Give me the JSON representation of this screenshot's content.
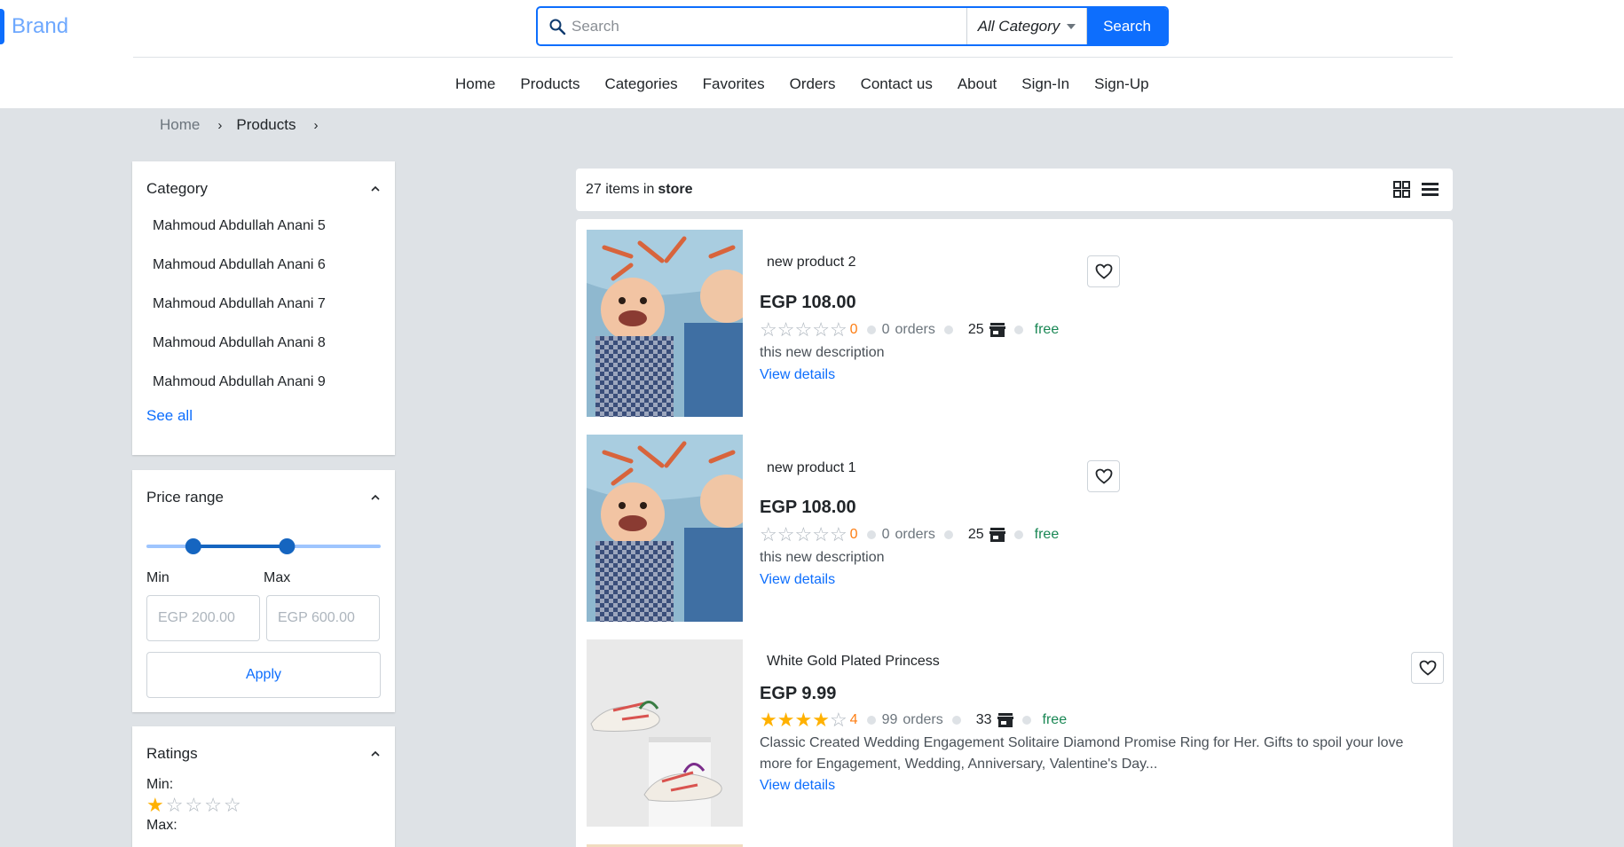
{
  "brand": {
    "name": "Brand",
    "accent": "#0d6efd"
  },
  "search": {
    "placeholder": "Search",
    "category_selected": "All Category",
    "button_label": "Search"
  },
  "nav": {
    "items": [
      "Home",
      "Products",
      "Categories",
      "Favorites",
      "Orders",
      "Contact us",
      "About",
      "Sign-In",
      "Sign-Up"
    ]
  },
  "breadcrumb": {
    "home": "Home",
    "current": "Products"
  },
  "sidebar": {
    "category": {
      "title": "Category",
      "items": [
        "Mahmoud Abdullah Anani 5",
        "Mahmoud Abdullah Anani 6",
        "Mahmoud Abdullah Anani 7",
        "Mahmoud Abdullah Anani 8",
        "Mahmoud Abdullah Anani 9"
      ],
      "see_all": "See all"
    },
    "price": {
      "title": "Price range",
      "range_min_fraction": 0.2,
      "range_max_fraction": 0.6,
      "min_label": "Min",
      "max_label": "Max",
      "min_placeholder": "EGP 200.00",
      "max_placeholder": "EGP 600.00",
      "apply_label": "Apply"
    },
    "ratings": {
      "title": "Ratings",
      "min_label": "Min:",
      "min_value": 1,
      "max_label": "Max:"
    }
  },
  "list_header": {
    "count_text": "27 items in",
    "store_word": "store"
  },
  "products": [
    {
      "title": "new product 2",
      "price": "EGP 108.00",
      "rating": 0,
      "rating_text": "0",
      "orders_count": "0",
      "orders_label": "orders",
      "stock": "25",
      "shipping": "free",
      "description": "this new description",
      "link": "View details",
      "image": "baby-photo"
    },
    {
      "title": "new product 1",
      "price": "EGP 108.00",
      "rating": 0,
      "rating_text": "0",
      "orders_count": "0",
      "orders_label": "orders",
      "stock": "25",
      "shipping": "free",
      "description": "this new description",
      "link": "View details",
      "image": "baby-photo"
    },
    {
      "title": "White Gold Plated Princess",
      "price": "EGP 9.99",
      "rating": 4,
      "rating_text": "4",
      "orders_count": "99",
      "orders_label": "orders",
      "stock": "33",
      "shipping": "free",
      "description": "Classic Created Wedding Engagement Solitaire Diamond Promise Ring for Her. Gifts to spoil your love more for Engagement, Wedding, Anniversary, Valentine's Day...",
      "link": "View details",
      "image": "sneakers-photo"
    }
  ],
  "colors": {
    "page_bg": "#dee2e6",
    "primary": "#0d6efd",
    "star_on": "#ffb100",
    "rating_number": "#fd7e14",
    "free": "#198754"
  }
}
